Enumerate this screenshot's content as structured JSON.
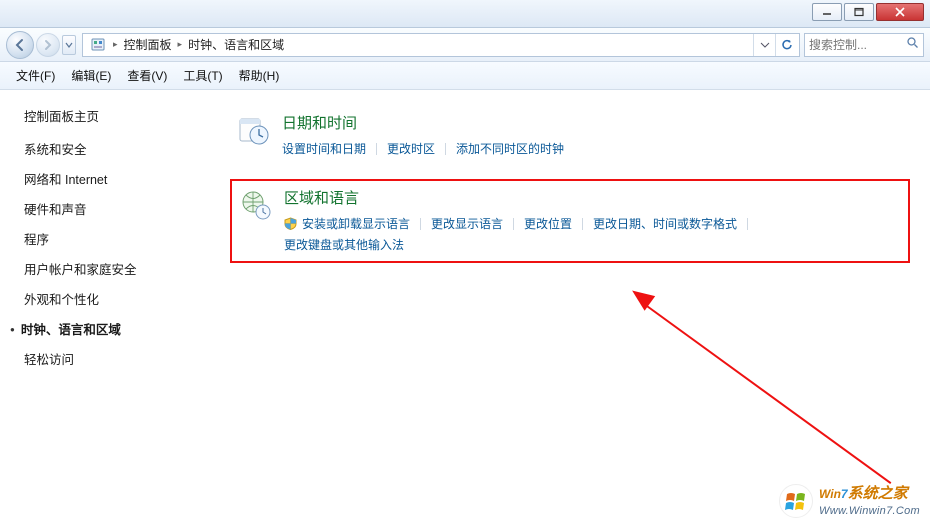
{
  "breadcrumb": {
    "item1": "控制面板",
    "item2": "时钟、语言和区域"
  },
  "search": {
    "placeholder": "搜索控制..."
  },
  "menu": {
    "file": "文件(F)",
    "edit": "编辑(E)",
    "view": "查看(V)",
    "tools": "工具(T)",
    "help": "帮助(H)"
  },
  "sidebar": {
    "home": "控制面板主页",
    "items": [
      "系统和安全",
      "网络和 Internet",
      "硬件和声音",
      "程序",
      "用户帐户和家庭安全",
      "外观和个性化",
      "时钟、语言和区域",
      "轻松访问"
    ],
    "active_index": 6
  },
  "sections": [
    {
      "title": "日期和时间",
      "tasks": [
        "设置时间和日期",
        "更改时区",
        "添加不同时区的时钟"
      ]
    },
    {
      "title": "区域和语言",
      "tasks_row1": [
        {
          "label": "安装或卸载显示语言",
          "shield": true
        },
        {
          "label": "更改显示语言"
        },
        {
          "label": "更改位置"
        },
        {
          "label": "更改日期、时间或数字格式"
        }
      ],
      "tasks_row2": [
        {
          "label": "更改键盘或其他输入法"
        }
      ]
    }
  ],
  "watermark": {
    "line1a": "Win",
    "line1b": "7",
    "line1c": "系统之家",
    "line2": "Www.Winwin7.Com"
  }
}
